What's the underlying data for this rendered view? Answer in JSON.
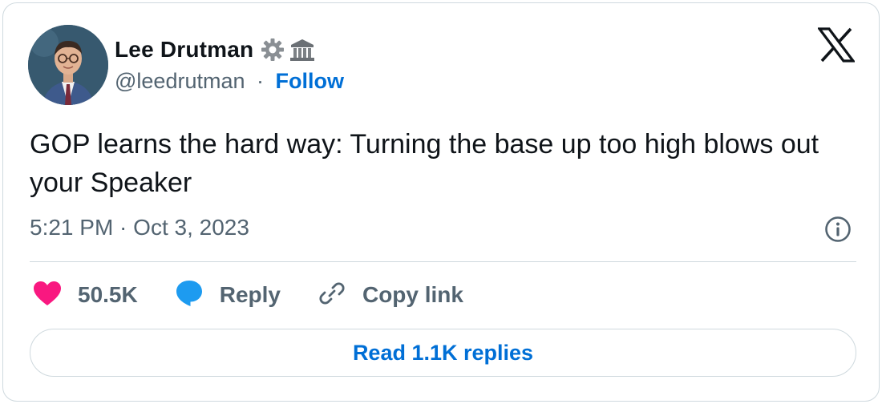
{
  "author": {
    "name": "Lee Drutman",
    "handle": "@leedrutman",
    "separator": "·",
    "follow_label": "Follow",
    "badges": [
      "gear-icon",
      "classical-building-icon"
    ]
  },
  "tweet": {
    "text": "GOP learns the hard way: Turning the base up too high blows out your Speaker",
    "timestamp": "5:21 PM · Oct 3, 2023"
  },
  "actions": {
    "like_count": "50.5K",
    "reply_label": "Reply",
    "copy_label": "Copy link"
  },
  "footer": {
    "read_replies_label": "Read 1.1K replies"
  },
  "colors": {
    "link": "#006fd6",
    "like": "#f91880",
    "reply": "#1d9bf0",
    "muted": "#536471",
    "text": "#0f1419",
    "border": "#cfd9de"
  }
}
